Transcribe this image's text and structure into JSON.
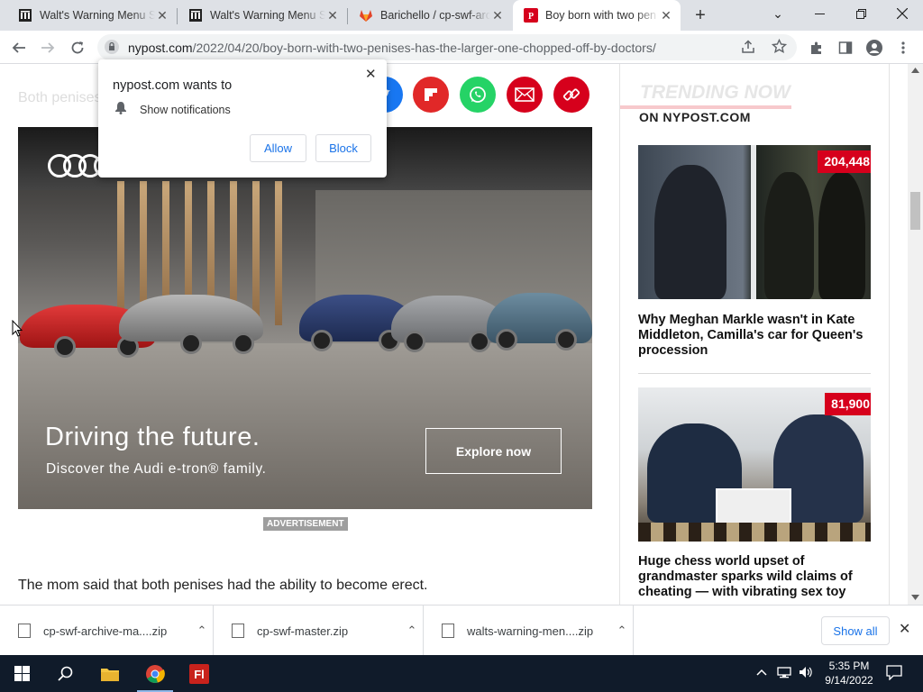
{
  "browser": {
    "tabs": [
      {
        "title": "Walt's Warning Menu S"
      },
      {
        "title": "Walt's Warning Menu S"
      },
      {
        "title": "Barichello / cp-swf-arc"
      },
      {
        "title": "Boy born with two pen"
      }
    ],
    "url_domain": "nypost.com",
    "url_path": "/2022/04/20/boy-born-with-two-penises-has-the-larger-one-chopped-off-by-doctors/"
  },
  "page": {
    "faded_text": "Both penises",
    "ad": {
      "headline": "Driving the future.",
      "subline": "Discover the Audi e-tron® family.",
      "cta": "Explore now",
      "label": "ADVERTISEMENT"
    },
    "body_text": "The mom said that both penises had the ability to become erect.",
    "sidebar": {
      "heading": "TRENDING NOW",
      "subheading": "ON NYPOST.COM",
      "cards": [
        {
          "badge": "204,448",
          "title": "Why Meghan Markle wasn't in Kate Middleton, Camilla's car for Queen's procession"
        },
        {
          "badge": "81,900",
          "title": "Huge chess world upset of grandmaster sparks wild claims of cheating — with vibrating sex toy"
        }
      ]
    }
  },
  "popup": {
    "title": "nypost.com wants to",
    "permission": "Show notifications",
    "allow": "Allow",
    "block": "Block"
  },
  "downloads": {
    "items": [
      {
        "name": "cp-swf-archive-ma....zip"
      },
      {
        "name": "cp-swf-master.zip"
      },
      {
        "name": "walts-warning-men....zip"
      }
    ],
    "show_all": "Show all"
  },
  "taskbar": {
    "time": "5:35 PM",
    "date": "9/14/2022"
  },
  "colors": {
    "nypost_red": "#d6001c",
    "facebook_blue": "#1877f2",
    "flipboard_red": "#e12828",
    "whatsapp_green": "#25d366",
    "link_blue": "#1a73e8"
  }
}
